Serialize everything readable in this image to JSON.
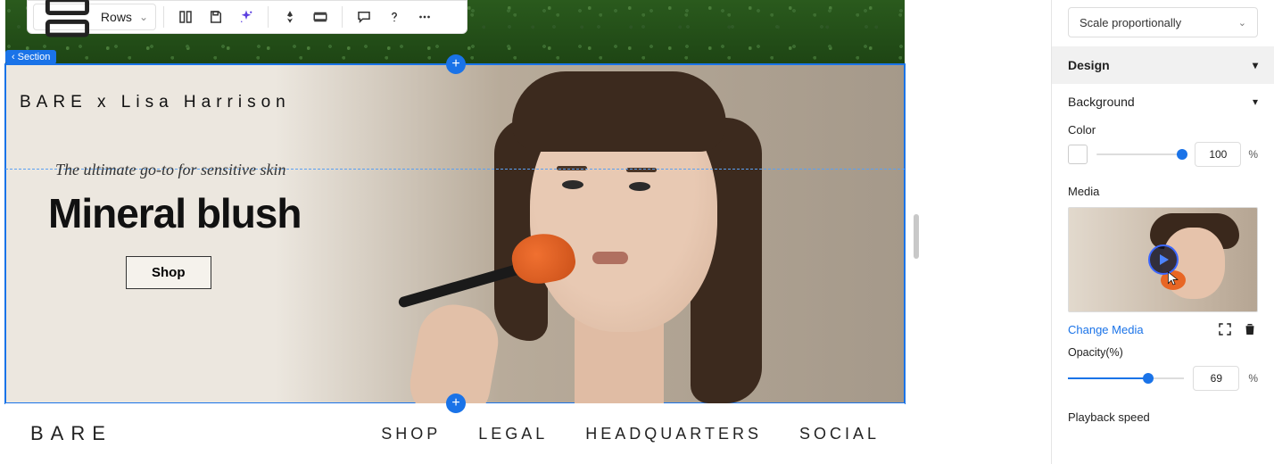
{
  "toolbar": {
    "layout_select": "Rows"
  },
  "section_tag": "Section",
  "hero": {
    "brand": "BARE x Lisa Harrison",
    "tagline": "The ultimate go-to for sensitive skin",
    "title": "Mineral blush",
    "cta": "Shop"
  },
  "nav": {
    "logo": "BARE",
    "items": [
      "SHOP",
      "LEGAL",
      "HEADQUARTERS",
      "SOCIAL"
    ]
  },
  "panel": {
    "scale_mode": "Scale proportionally",
    "design_header": "Design",
    "background_label": "Background",
    "color_label": "Color",
    "color_opacity_value": "100",
    "percent": "%",
    "media_label": "Media",
    "change_media": "Change Media",
    "opacity_label": "Opacity(%)",
    "opacity_value": "69",
    "playback_label": "Playback speed"
  }
}
